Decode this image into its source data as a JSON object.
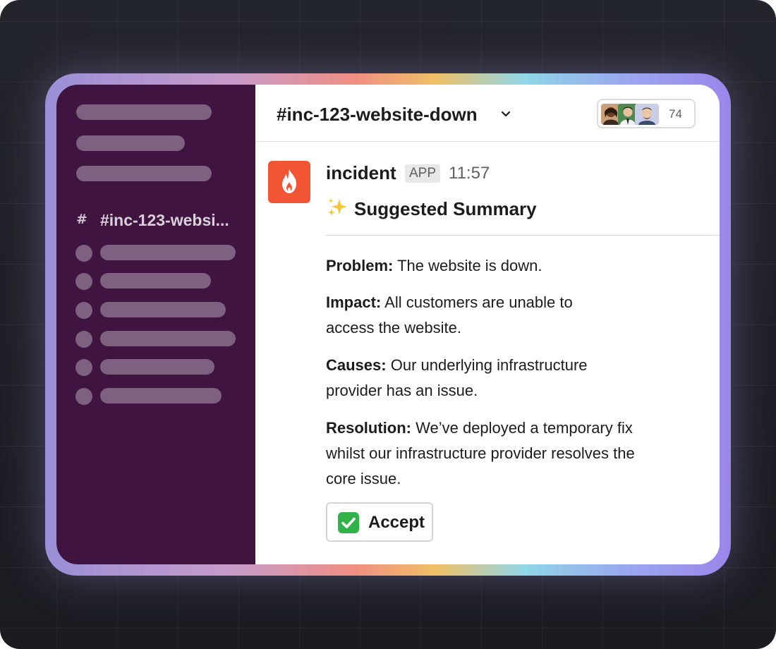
{
  "sidebar": {
    "channel": {
      "hash": "#",
      "label": "#inc-123-websi..."
    }
  },
  "header": {
    "channel_title": "#inc-123-website-down",
    "member_count": "74"
  },
  "message": {
    "sender": "incident",
    "badge": "APP",
    "time": "11:57",
    "title": "Suggested Summary",
    "fields": [
      {
        "label": "Problem:",
        "text": "The website is down."
      },
      {
        "label": "Impact:",
        "text": "All customers are unable to access the website."
      },
      {
        "label": "Causes:",
        "text": "Our underlying infrastructure provider has an issue."
      },
      {
        "label": "Resolution:",
        "text": "We’ve deployed a temporary fix whilst our infrastructure provider resolves the core issue."
      }
    ],
    "accept_label": "Accept"
  },
  "colors": {
    "sidebar_bg": "#3f1440",
    "app_icon": "#f25533",
    "accept_check": "#32b34a"
  },
  "icons": {
    "app_logo": "flame-icon",
    "title_prefix": "sparkles-icon",
    "accept_prefix": "check-mark-icon",
    "dropdown": "chevron-down-icon"
  }
}
